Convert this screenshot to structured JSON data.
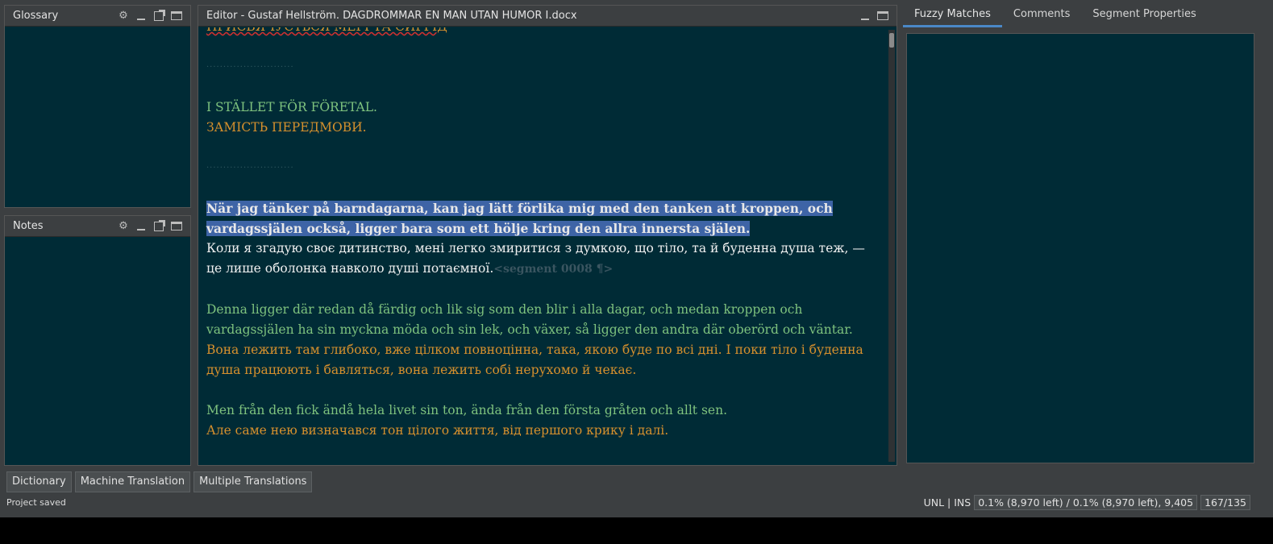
{
  "glossary": {
    "title": "Glossary"
  },
  "notes": {
    "title": "Notes"
  },
  "editor": {
    "title": "Editor - Gustaf Hellström. DAGDRÖMMAR EN MAN UTAN HUMOR I.docx",
    "partial_top_line": "ПРИСВЯЧУЄТЬСЯ МЕРІ ТА СИГРІД",
    "seg_heading_src": "I STÄLLET FÖR FÖRETAL.",
    "seg_heading_tgt": "ЗАМІСТЬ ПЕРЕДМОВИ.",
    "active_src_line1": "När jag tänker på barndagarna, kan jag lätt förlika mig med den tanken att kroppen, och",
    "active_src_line2": "vardagssjälen också, ligger bara som ett hölje kring den allra innersta själen.",
    "active_tgt_line1": "Коли я згадую своє дитинство, мені легко змиритися з думкою, що тіло, та й буденна душа теж, —",
    "active_tgt_line2": "це лише оболонка навколо душі потаємної.",
    "segment_marker": "<segment 0008 ¶>",
    "seg9_src_line1": "Denna ligger där redan då färdig och lik sig som den blir i alla dagar, och medan kroppen och",
    "seg9_src_line2": "vardagssjälen ha sin myckna möda och sin lek, och växer, så ligger den andra där oberörd och väntar.",
    "seg9_tgt_line1": "Вона лежить там глибоко, вже цілком повноцінна, така, якою буде по всі дні. І поки тіло і буденна",
    "seg9_tgt_line2": "душа працюють і бавляться, вона лежить собі нерухомо й чекає.",
    "seg10_src": "Men från den fick ändå hela livet sin ton, ända från den första gråten och allt sen.",
    "seg10_tgt": "Але саме нею визначався тон цілого життя, від першого крику і далі.",
    "separator": "··························"
  },
  "right_tabs": [
    "Fuzzy Matches",
    "Comments",
    "Segment Properties"
  ],
  "bottom_tabs": [
    "Dictionary",
    "Machine Translation",
    "Multiple Translations"
  ],
  "status": {
    "left": "Project saved",
    "mode": "UNL | INS",
    "progress": "0.1% (8,970 left) / 0.1% (8,970 left), 9,405",
    "chars": "167/135"
  },
  "icons": [
    "gear-icon",
    "minimize-icon",
    "popout-icon",
    "maximize-icon"
  ],
  "colors": {
    "background": "#002b36",
    "source_text": "#7ec27e",
    "target_text": "#d6902d",
    "selection": "#3e64a6",
    "active_tab": "#4a88c7"
  }
}
